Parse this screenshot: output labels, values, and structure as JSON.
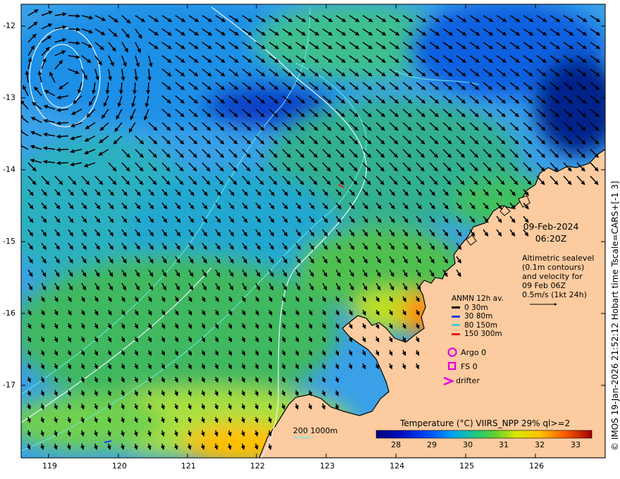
{
  "map": {
    "lon_ticks": [
      "119",
      "120",
      "121",
      "122",
      "123",
      "124",
      "125",
      "126"
    ],
    "lat_ticks": [
      "-12",
      "-13",
      "-14",
      "-15",
      "-16",
      "-17"
    ],
    "date": "09-Feb-2024",
    "time": "06:20Z",
    "info_lines": [
      "Altimetric sealevel",
      "(0.1m contours)",
      "and velocity for",
      "09 Feb 06Z",
      "0.5m/s (1kt 24h)"
    ],
    "legend_title": "ANMN 12h av.",
    "legend_items": [
      {
        "label": "0 30m",
        "color": "#000000"
      },
      {
        "label": "30 80m",
        "color": "#1a3cff"
      },
      {
        "label": "80 150m",
        "color": "#3fd0d0"
      },
      {
        "label": "150 300m",
        "color": "#e02020"
      }
    ],
    "markers": [
      {
        "label": "Argo 0",
        "color": "#e000e0"
      },
      {
        "label": "FS 0",
        "color": "#e000e0"
      },
      {
        "label": "drifter",
        "color": "#e000e0"
      }
    ],
    "bathy_label": "200  1000m",
    "colorbar": {
      "title": "Temperature (°C) VIIRS_NPP 29% ql>=2",
      "ticks": [
        "28",
        "29",
        "30",
        "31",
        "32",
        "33"
      ]
    },
    "side_text": "© IMOS 19-Jan-2026 21:52:12 Hobart time Tscale=CARS+[-1 3]",
    "colors": {
      "land": "#fccb9f",
      "coast": "#000000",
      "contour": "#e8f4ff"
    }
  }
}
